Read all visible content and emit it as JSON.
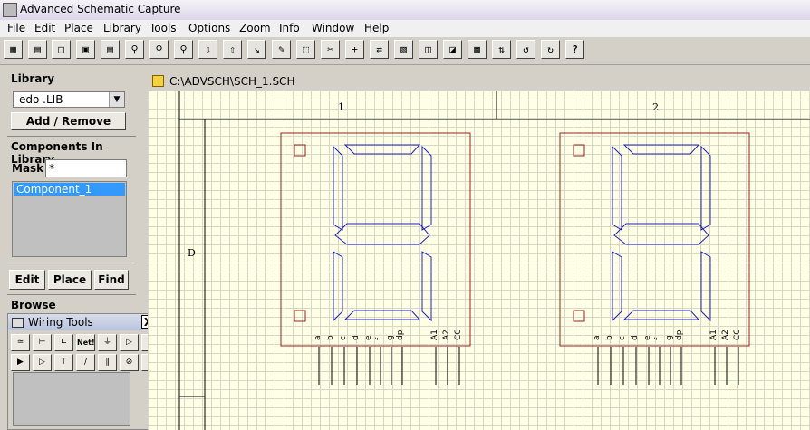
{
  "window": {
    "title": "Advanced Schematic Capture"
  },
  "menu": [
    "File",
    "Edit",
    "Place",
    "Library",
    "Tools",
    "Options",
    "Zoom",
    "Info",
    "Window",
    "Help"
  ],
  "toolbar": {
    "buttons": [
      "new-icon",
      "open-library-icon",
      "open-icon",
      "save-icon",
      "print-icon",
      "zoom-in-icon",
      "zoom-out-icon",
      "zoom-fit-icon",
      "arrow-down-icon",
      "arrow-up-icon",
      "wire-icon",
      "pencil-icon",
      "select-box-icon",
      "cut-icon",
      "cross-icon",
      "align-icon",
      "component-icon",
      "shield-icon",
      "shield-flag-icon",
      "chip-icon",
      "move-icon",
      "undo-icon",
      "redo-icon",
      "help-icon"
    ],
    "help_label": "?"
  },
  "library": {
    "title": "Library",
    "selected": "edo  .LIB",
    "add_remove": "Add / Remove"
  },
  "components": {
    "title": "Components In Library",
    "mask_label": "Mask",
    "mask_value": "*",
    "items": [
      "Component_1"
    ]
  },
  "actions": {
    "edit": "Edit",
    "place": "Place",
    "find": "Find"
  },
  "browse": {
    "title": "Browse"
  },
  "wiring_tools": {
    "title": "Wiring Tools",
    "close": "X",
    "netl_label": "Net!"
  },
  "document": {
    "path": "C:\\ADVSCH\\SCH_1.SCH"
  },
  "sheet": {
    "col_labels": [
      "1",
      "2"
    ],
    "row_labels": [
      "D"
    ]
  },
  "components_on_sheet": [
    {
      "pins": [
        "a",
        "b",
        "c",
        "d",
        "e",
        "f",
        "g",
        "dp"
      ],
      "extra": [
        "A1",
        "A2",
        "CC"
      ]
    },
    {
      "pins": [
        "a",
        "b",
        "c",
        "d",
        "e",
        "f",
        "g",
        "dp"
      ],
      "extra": [
        "A1",
        "A2",
        "CC"
      ]
    }
  ],
  "colors": {
    "segment": "#2020c0",
    "body": "#9a2020",
    "grid": "#d8d8c8",
    "canvas": "#ffffe6",
    "selection": "#3399ff"
  }
}
